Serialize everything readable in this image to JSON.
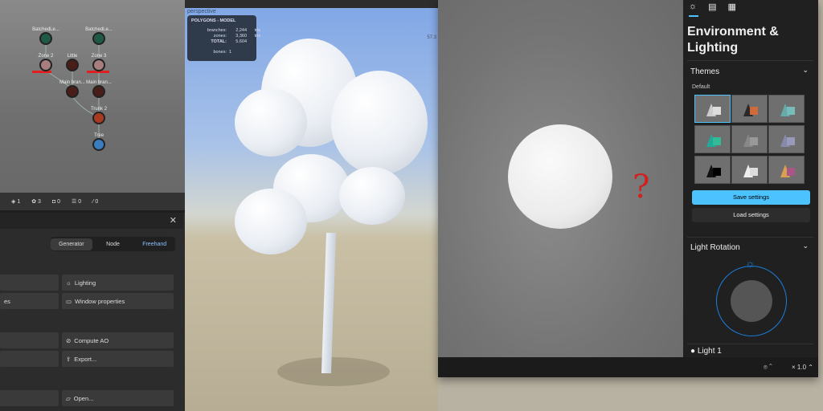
{
  "node_graph": {
    "nodes": [
      {
        "label": "BatchedLe...",
        "color": "#1f5a44"
      },
      {
        "label": "BatchedLe...",
        "color": "#1f5a44"
      },
      {
        "label": "Zone 2",
        "color": "#a77d7d"
      },
      {
        "label": "Little",
        "color": "#4a1e18"
      },
      {
        "label": "Zone 3",
        "color": "#a77d7d"
      },
      {
        "label": "Main bran...",
        "color": "#4a1e18"
      },
      {
        "label": "Main bran...",
        "color": "#4a1e18"
      },
      {
        "label": "Trunk 2",
        "color": "#a83a20"
      },
      {
        "label": "Tree",
        "color": "#3a7cc0"
      }
    ]
  },
  "stats_bar": {
    "items": [
      {
        "icon": "tag-icon",
        "value": "1"
      },
      {
        "icon": "material-icon",
        "value": "3"
      },
      {
        "icon": "camera-icon",
        "value": "0"
      },
      {
        "icon": "layers-icon",
        "value": "0"
      },
      {
        "icon": "bone-icon",
        "value": "0"
      }
    ]
  },
  "panel": {
    "close": "✕",
    "modes": [
      "Generator",
      "Node",
      "Freehand"
    ],
    "buttons": [
      "Lighting",
      "Window properties",
      "Compute AO",
      "Export...",
      "Open..."
    ],
    "left_partial": "es"
  },
  "viewport": {
    "label": "perspective",
    "ruler": "57.3",
    "polygons": {
      "title": "POLYGONS - MODEL",
      "branches_label": "branches:",
      "branches": "2,244",
      "zones_label": "zones:",
      "zones": "3,360",
      "tris": "tris",
      "total_label": "TOTAL:",
      "total": "5,604",
      "bones_label": "bones:",
      "bones": "1"
    }
  },
  "right_window": {
    "annotation": "?",
    "title": "Environment & Lighting",
    "themes": {
      "label": "Themes",
      "group": "Default",
      "count": 9,
      "selected": 0
    },
    "save": "Save settings",
    "load": "Load settings",
    "light_rotation": "Light Rotation",
    "light1": "Light 1",
    "zoom": "× 1.0",
    "accent": "#4cc2ff"
  }
}
